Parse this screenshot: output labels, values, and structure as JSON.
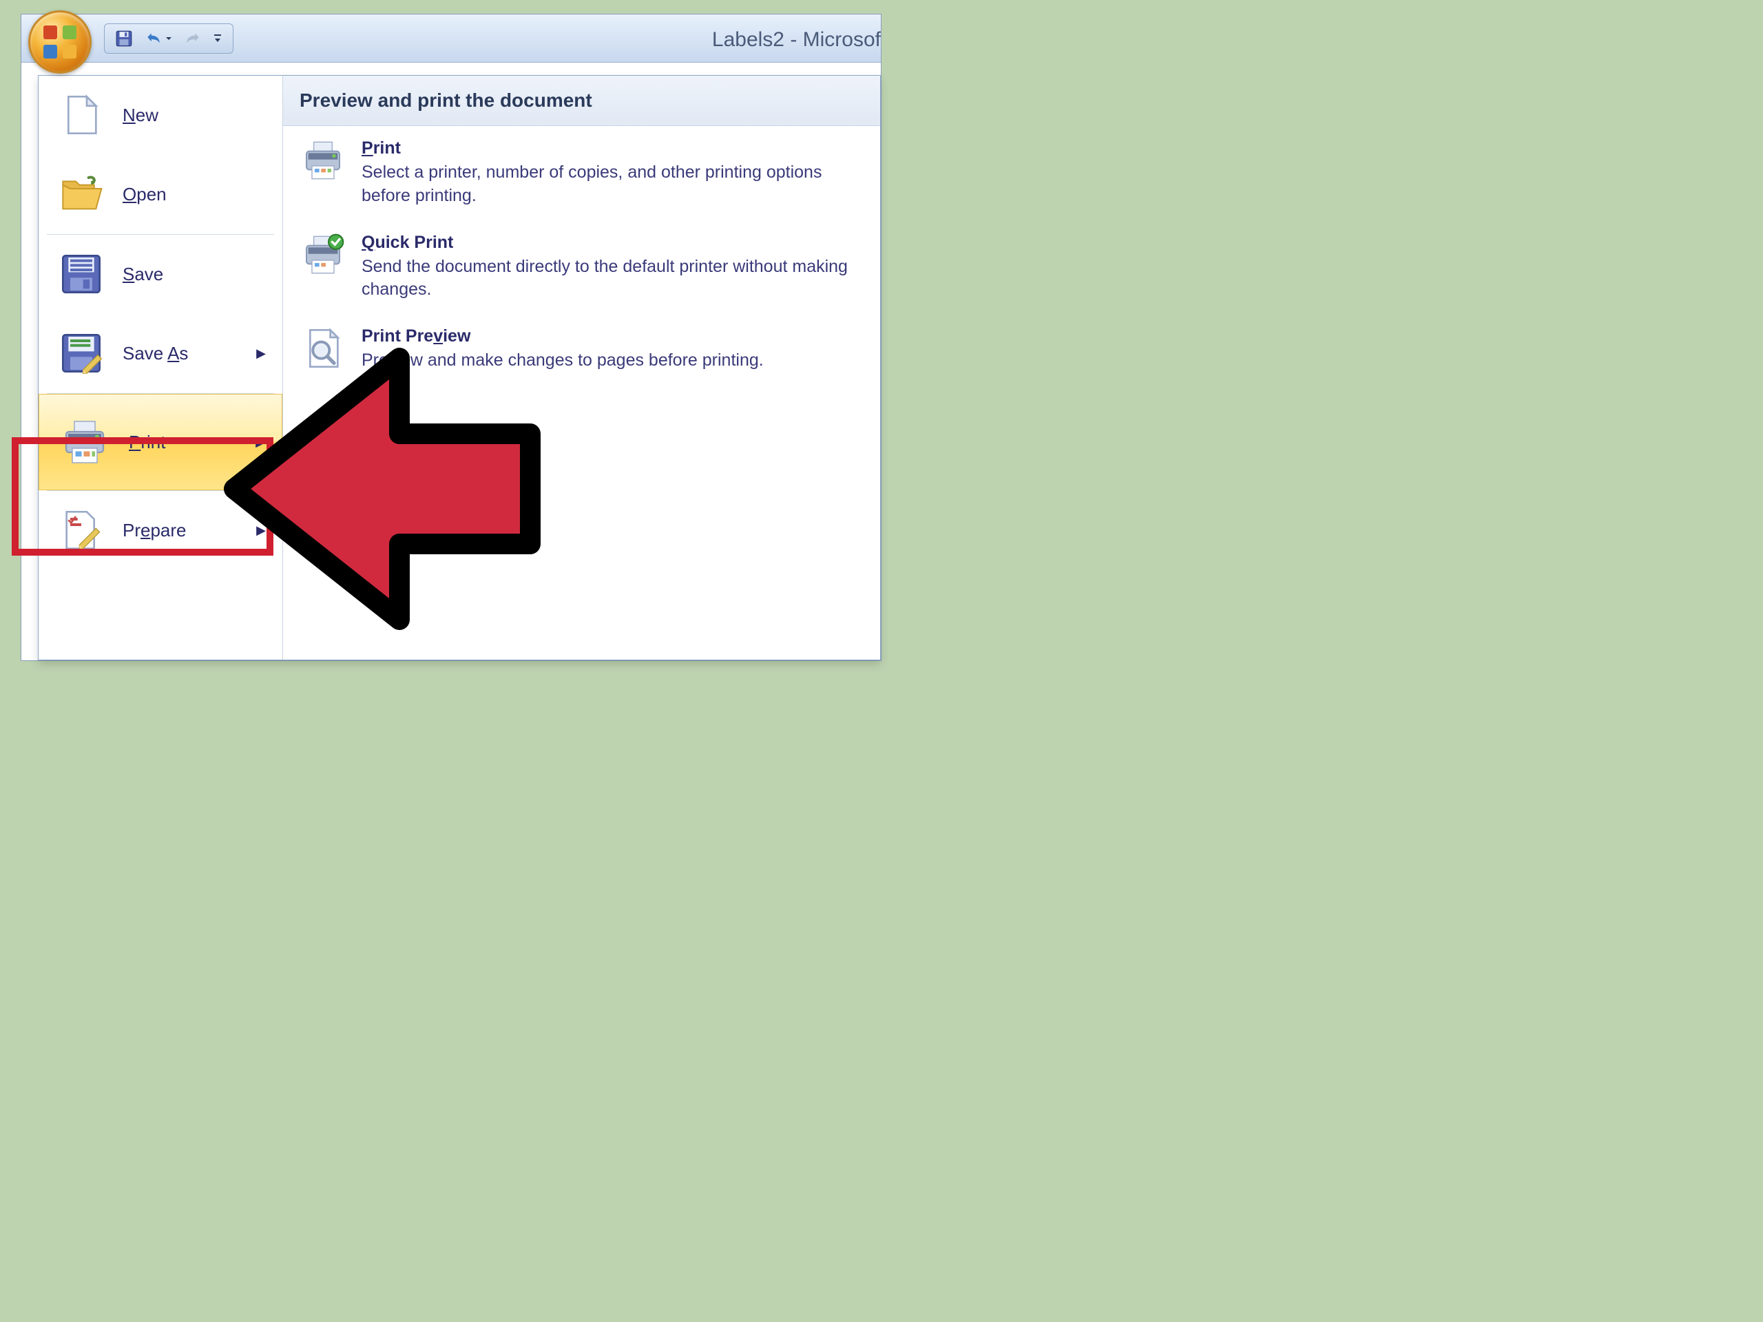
{
  "titlebar": {
    "title": "Labels2 - Microsof"
  },
  "qat": {
    "save": "Save",
    "undo": "Undo",
    "redo": "Redo",
    "customize": "Customize Quick Access Toolbar"
  },
  "menu": {
    "items": [
      {
        "label": "New",
        "accel": "N",
        "rest": "ew"
      },
      {
        "label": "Open",
        "accel": "O",
        "rest": "pen"
      },
      {
        "label": "Save",
        "accel": "S",
        "rest": "ave"
      },
      {
        "label": "Save As",
        "accel": "A",
        "pre": "Save ",
        "rest": "s",
        "submenu": true
      },
      {
        "label": "Print",
        "accel": "P",
        "rest": "rint",
        "submenu": true,
        "highlighted": true
      },
      {
        "label": "Prepare",
        "accel": "e",
        "pre": "Pr",
        "rest": "pare",
        "submenu": true
      }
    ]
  },
  "rightPanel": {
    "header": "Preview and print the document",
    "options": [
      {
        "title": "Print",
        "accel": "P",
        "rest": "rint",
        "desc": "Select a printer, number of copies, and other printing options before printing."
      },
      {
        "title": "Quick Print",
        "accel": "Q",
        "rest": "uick Print",
        "desc": "Send the document directly to the default printer without making changes."
      },
      {
        "title": "Print Preview",
        "pre": "Print Pre",
        "accel": "v",
        "rest": "iew",
        "desc": "Preview and make changes to pages before printing."
      }
    ]
  }
}
